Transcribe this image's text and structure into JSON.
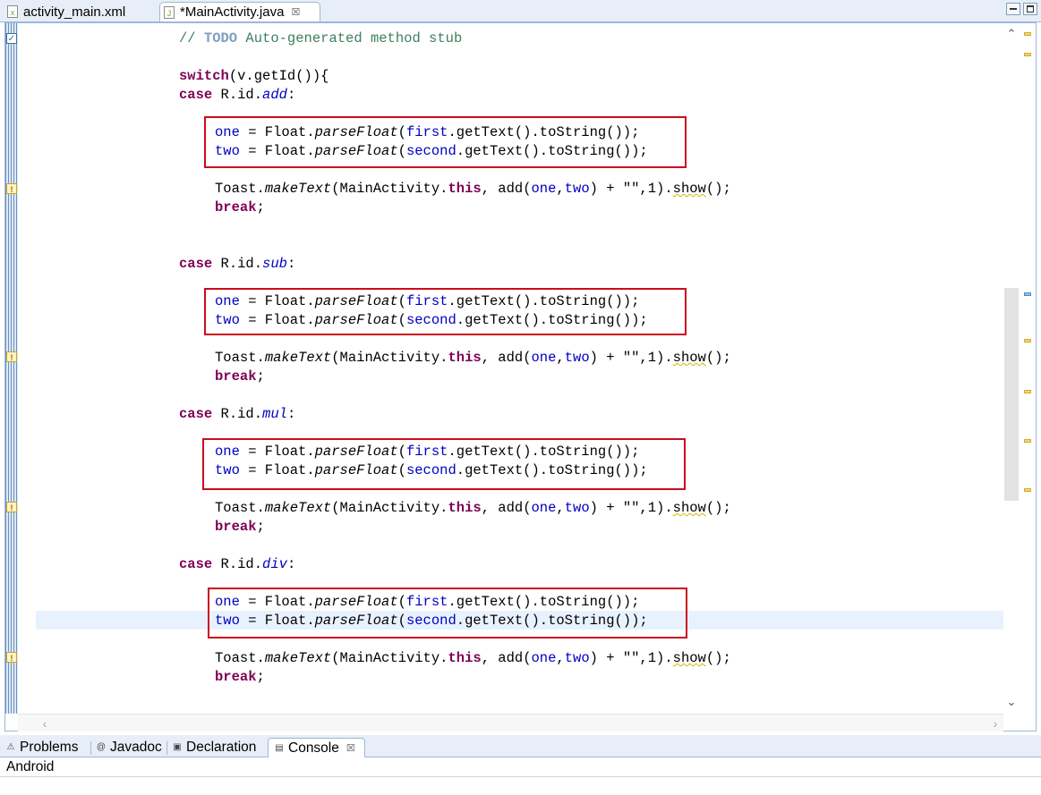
{
  "editor_tabs": [
    {
      "label": "activity_main.xml",
      "icon": "xml-file-icon",
      "active": false
    },
    {
      "label": "*MainActivity.java",
      "icon": "java-file-icon",
      "active": true,
      "close": "☒"
    }
  ],
  "code": {
    "comment_prefix": "// ",
    "todo": "TODO",
    "comment_rest": " Auto-generated method stub",
    "switch_kw": "switch",
    "switch_rest": "(v.getId()){",
    "case_kw": "case",
    "rid": " R.id.",
    "colon": ":",
    "case_ids": [
      "add",
      "sub",
      "mul",
      "div"
    ],
    "var_one": "one",
    "var_two": "two",
    "assign": " = Float.",
    "parse": "parseFloat",
    "paren_open": "(",
    "field_first": "first",
    "field_second": "second",
    "get_text": ".getText().toString());",
    "toast": "Toast.",
    "make_text": "makeText",
    "toast_mid": "(MainActivity.",
    "this_kw": "this",
    "add_call": ", add(",
    "comma": ",",
    "toast_tail": ") + \"\",1).",
    "show": "show",
    "show_tail": "();",
    "break_kw": "break",
    "semicolon": ";"
  },
  "console_panel": {
    "tabs": [
      {
        "label": "Problems",
        "icon": "problems-icon"
      },
      {
        "label": "Javadoc",
        "icon": "at-icon"
      },
      {
        "label": "Declaration",
        "icon": "declaration-icon"
      },
      {
        "label": "Console",
        "icon": "console-icon",
        "active": true,
        "close": "☒"
      }
    ],
    "title": "Android"
  },
  "colors": {
    "keyword": "#7f0055",
    "field": "#0000c0",
    "comment": "#3f7f5f",
    "highlight_box": "#cc0c1c",
    "current_line": "#e8f2fe"
  }
}
